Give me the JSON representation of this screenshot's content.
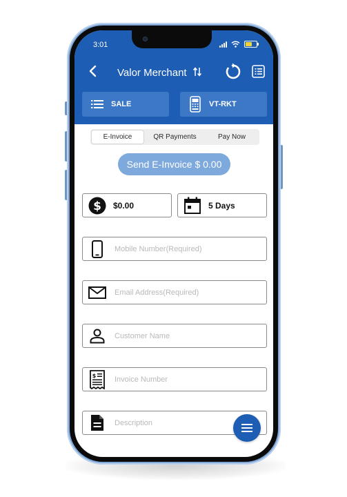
{
  "status_bar": {
    "time": "3:01"
  },
  "navbar": {
    "title": "Valor Merchant"
  },
  "tiles": {
    "sale_label": "SALE",
    "terminal_label": "VT-RKT"
  },
  "tabs": [
    "E-Invoice",
    "QR Payments",
    "Pay Now"
  ],
  "active_tab": "E-Invoice",
  "send_button": {
    "label": "Send E-Invoice $ 0.00"
  },
  "amount": {
    "value": "$0.00"
  },
  "days": {
    "value": "5 Days"
  },
  "fields": {
    "mobile": "Mobile Number(Required)",
    "email": "Email Address(Required)",
    "customer": "Customer Name",
    "invoice": "Invoice Number",
    "description": "Description"
  },
  "colors": {
    "header": "#1d5db4",
    "tile": "#3d78c6",
    "send_button": "#7ea9dd",
    "phone_frame": "#7fa6d4",
    "battery": "#f2d43a"
  },
  "icons": {
    "back": "chevron-left-icon",
    "swap": "swap-arrows-icon",
    "refresh": "refresh-icon",
    "receipt": "receipt-list-icon",
    "sale": "list-icon",
    "terminal": "card-terminal-icon",
    "amount": "dollar-circle-icon",
    "days": "calendar-icon",
    "mobile": "phone-icon",
    "email": "envelope-icon",
    "customer": "person-icon",
    "invoice": "invoice-icon",
    "description": "document-icon",
    "fab": "menu-icon"
  }
}
